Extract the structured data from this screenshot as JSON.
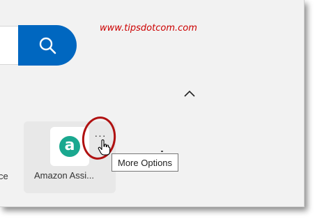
{
  "watermark": {
    "text": "www.tipsdotcom.com"
  },
  "search": {
    "button_icon": "search-icon"
  },
  "apps_section": {
    "collapse_icon": "chevron-up-icon"
  },
  "app_list": {
    "left_partial_label": "ce",
    "items": [
      {
        "name": "Amazon Assi...",
        "icon_letter": "a",
        "icon": "amazon-assistant-icon"
      }
    ],
    "more_options_label": "···",
    "tooltip": "More Options"
  },
  "colors": {
    "accent": "#0067c0",
    "watermark": "#cc0000",
    "highlight_ring": "#b01111",
    "app_icon": "#1aa88f"
  }
}
